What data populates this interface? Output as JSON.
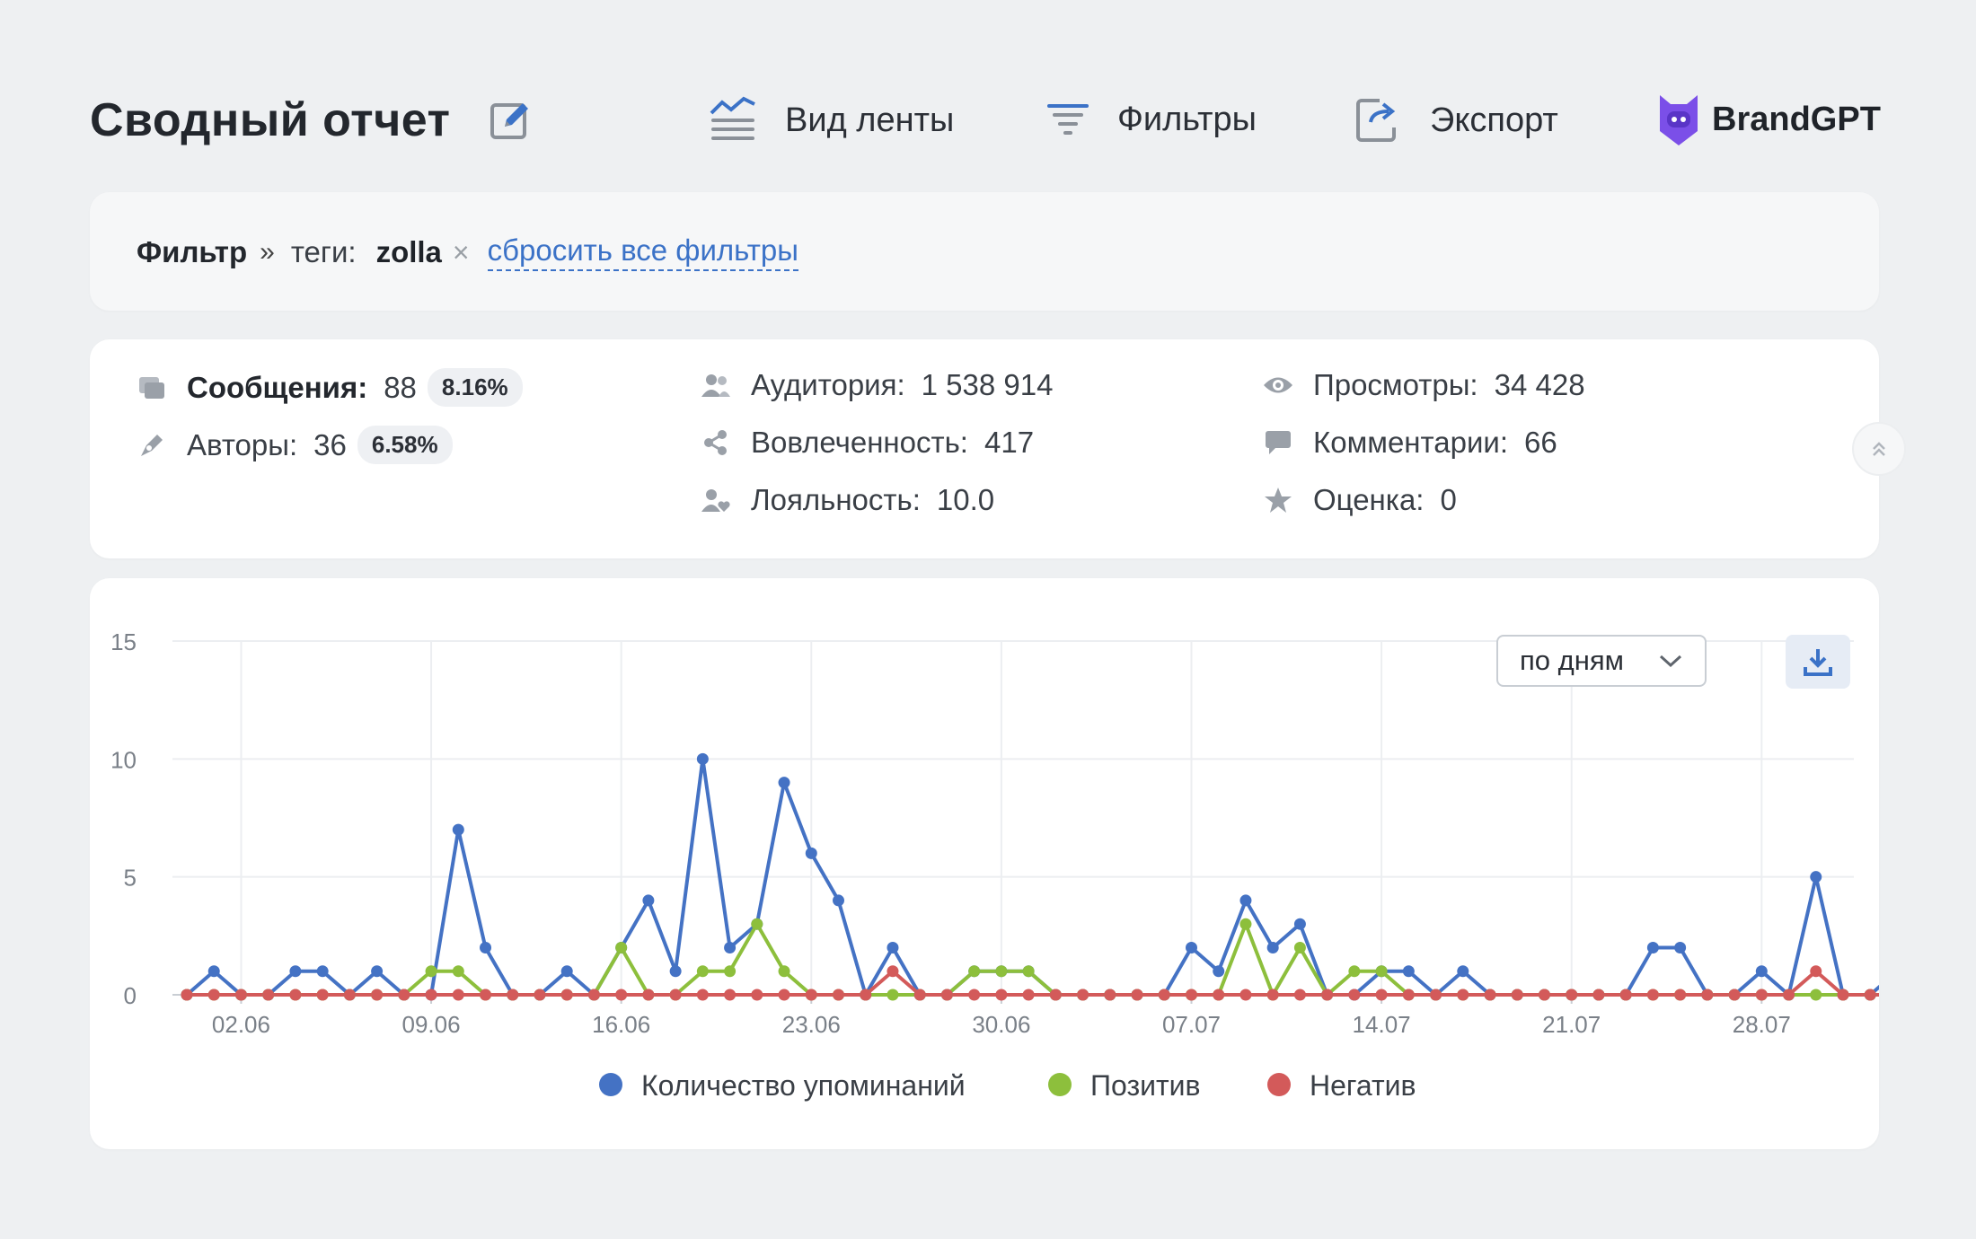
{
  "header": {
    "title": "Сводный отчет",
    "nav": {
      "feed_view": "Вид ленты",
      "filters": "Фильтры",
      "export": "Экспорт",
      "brandgpt": "BrandGPT"
    }
  },
  "filter": {
    "label": "Фильтр",
    "separator": "»",
    "tag_key": "теги:",
    "tag_value": "zolla",
    "remove": "×",
    "reset": "сбросить все фильтры"
  },
  "stats": {
    "messages": {
      "label": "Сообщения:",
      "value": "88",
      "pct": "8.16%"
    },
    "authors": {
      "label": "Авторы:",
      "value": "36",
      "pct": "6.58%"
    },
    "audience": {
      "label": "Аудитория:",
      "value": "1 538 914"
    },
    "engagement": {
      "label": "Вовлеченность:",
      "value": "417"
    },
    "loyalty": {
      "label": "Лояльность:",
      "value": "10.0"
    },
    "views": {
      "label": "Просмотры:",
      "value": "34 428"
    },
    "comments": {
      "label": "Комментарии:",
      "value": "66"
    },
    "rating": {
      "label": "Оценка:",
      "value": "0"
    }
  },
  "chart_controls": {
    "period": "по дням"
  },
  "colors": {
    "mentions": "#4472c4",
    "positive": "#8dbf3c",
    "negative": "#d35a5a",
    "link": "#3b72c7"
  },
  "chart_data": {
    "type": "line",
    "x": [
      "31.05",
      "01.06",
      "02.06",
      "03.06",
      "04.06",
      "05.06",
      "06.06",
      "07.06",
      "08.06",
      "09.06",
      "10.06",
      "11.06",
      "12.06",
      "13.06",
      "14.06",
      "15.06",
      "16.06",
      "17.06",
      "18.06",
      "19.06",
      "20.06",
      "21.06",
      "22.06",
      "23.06",
      "24.06",
      "25.06",
      "26.06",
      "27.06",
      "28.06",
      "29.06",
      "30.06",
      "01.07",
      "02.07",
      "03.07",
      "04.07",
      "05.07",
      "06.07",
      "07.07",
      "08.07",
      "09.07",
      "10.07",
      "11.07",
      "12.07",
      "13.07",
      "14.07",
      "15.07",
      "16.07",
      "17.07",
      "18.07",
      "19.07",
      "20.07",
      "21.07",
      "22.07",
      "23.07",
      "24.07",
      "25.07",
      "26.07",
      "27.07",
      "28.07",
      "29.07",
      "30.07",
      "31.07"
    ],
    "x_ticks": [
      "02.06",
      "09.06",
      "16.06",
      "23.06",
      "30.06",
      "07.07",
      "14.07",
      "21.07",
      "28.07"
    ],
    "ylim": [
      0,
      15
    ],
    "y_ticks": [
      0,
      5,
      10,
      15
    ],
    "grid": true,
    "legend_position": "bottom",
    "series": [
      {
        "name": "Количество упоминаний",
        "values": [
          0,
          1,
          0,
          0,
          1,
          1,
          0,
          1,
          0,
          0,
          7,
          2,
          0,
          0,
          1,
          0,
          2,
          4,
          1,
          10,
          2,
          3,
          9,
          6,
          4,
          0,
          2,
          0,
          0,
          1,
          1,
          1,
          0,
          0,
          0,
          0,
          0,
          2,
          1,
          4,
          2,
          3,
          0,
          0,
          1,
          1,
          0,
          1,
          0,
          0,
          0,
          0,
          0,
          0,
          2,
          2,
          0,
          0,
          1,
          0,
          5,
          0,
          0,
          1
        ]
      },
      {
        "name": "Позитив",
        "values": [
          0,
          0,
          0,
          0,
          0,
          0,
          0,
          0,
          0,
          1,
          1,
          0,
          0,
          0,
          0,
          0,
          2,
          0,
          0,
          1,
          1,
          3,
          1,
          0,
          0,
          0,
          0,
          0,
          0,
          1,
          1,
          1,
          0,
          0,
          0,
          0,
          0,
          0,
          0,
          3,
          0,
          2,
          0,
          1,
          1,
          0,
          0,
          0,
          0,
          0,
          0,
          0,
          0,
          0,
          0,
          0,
          0,
          0,
          0,
          0,
          0,
          0,
          0,
          0
        ]
      },
      {
        "name": "Негатив",
        "values": [
          0,
          0,
          0,
          0,
          0,
          0,
          0,
          0,
          0,
          0,
          0,
          0,
          0,
          0,
          0,
          0,
          0,
          0,
          0,
          0,
          0,
          0,
          0,
          0,
          0,
          0,
          1,
          0,
          0,
          0,
          0,
          0,
          0,
          0,
          0,
          0,
          0,
          0,
          0,
          0,
          0,
          0,
          0,
          0,
          0,
          0,
          0,
          0,
          0,
          0,
          0,
          0,
          0,
          0,
          0,
          0,
          0,
          0,
          0,
          0,
          1,
          0,
          0,
          0
        ]
      }
    ]
  }
}
